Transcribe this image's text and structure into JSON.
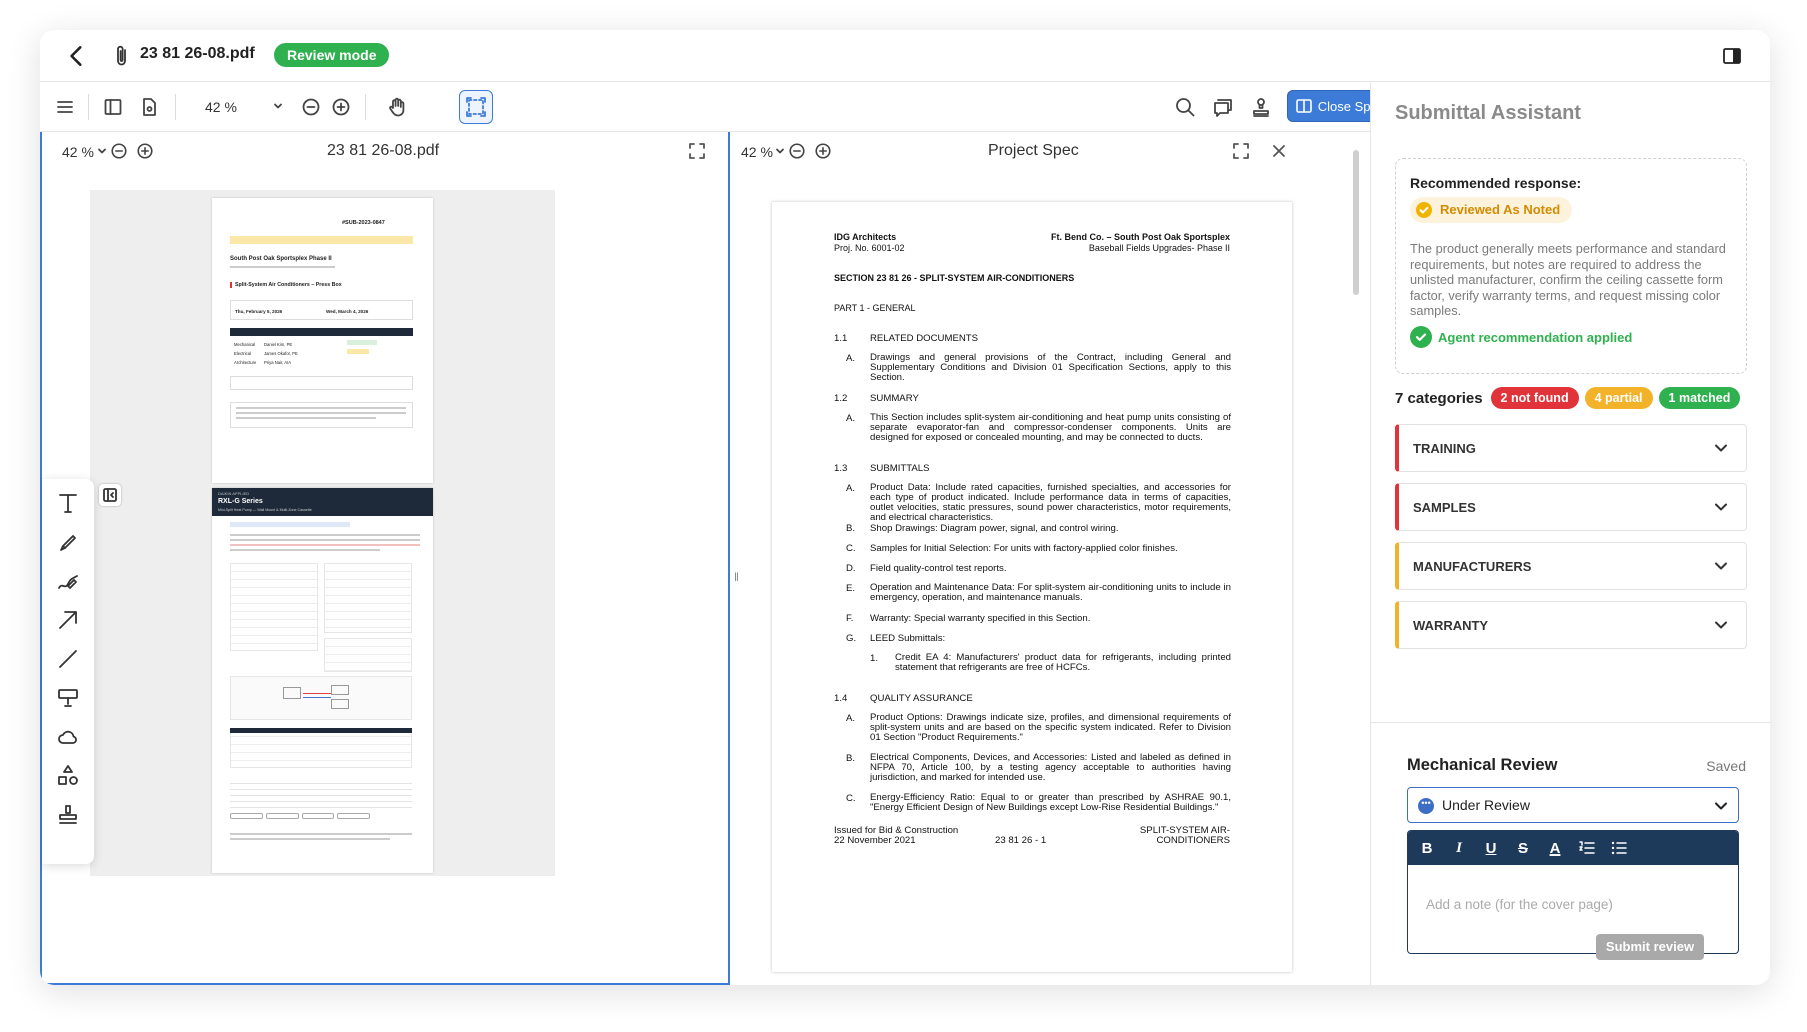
{
  "header": {
    "filename": "23 81 26-08.pdf",
    "mode_badge": "Review mode"
  },
  "toolbar": {
    "zoom": "42 %",
    "close_spec": "Close Spec"
  },
  "left_pane": {
    "zoom": "42 %",
    "title": "23 81 26-08.pdf"
  },
  "right_pane": {
    "zoom": "42 %",
    "title": "Project Spec"
  },
  "thumb1": {
    "id": "#SUB-2023-0847",
    "project": "South Post Oak Sportsplex Phase II",
    "item": "Split-System Air Conditioners – Press Box",
    "received": "Thu, February 5, 2026",
    "due": "Wed, March 4, 2026",
    "disciplines": [
      "Mechanical",
      "Electrical",
      "Architecture"
    ],
    "reviewers": [
      "Daniel Kim, PE",
      "James Okafor, PE",
      "Priya Nair, AIA"
    ]
  },
  "thumb2": {
    "brand": "DAIKIN APPLIED",
    "series": "RXL-G Series",
    "sub": "Mini-Split Heat Pump — Wall Mount & Multi-Zone Cassette"
  },
  "spec": {
    "firm": "IDG Architects",
    "proj_no": "Proj. No. 6001-02",
    "client": "Ft. Bend Co. – South Post Oak Sportsplex",
    "client2": "Baseball Fields Upgrades- Phase II",
    "section": "SECTION 23 81 26 - SPLIT-SYSTEM AIR-CONDITIONERS",
    "part": "PART 1 - GENERAL",
    "h11n": "1.1",
    "h11": "RELATED DOCUMENTS",
    "p11a": "Drawings and general provisions of the Contract, including General and Supplementary Conditions and Division 01 Specification Sections, apply to this Section.",
    "h12n": "1.2",
    "h12": "SUMMARY",
    "p12a": "This Section includes split-system air-conditioning and heat pump units consisting of separate evaporator-fan and compressor-condenser components. Units are designed for exposed or concealed mounting, and may be connected to ducts.",
    "h13n": "1.3",
    "h13": "SUBMITTALS",
    "p13a": "Product Data: Include rated capacities, furnished specialties, and accessories for each type of product indicated. Include performance data in terms of capacities, outlet velocities, static pressures, sound power characteristics, motor requirements, and electrical characteristics.",
    "p13b": "Shop Drawings: Diagram power, signal, and control wiring.",
    "p13c": "Samples for Initial Selection: For units with factory-applied color finishes.",
    "p13d": "Field quality-control test reports.",
    "p13e": "Operation and Maintenance Data: For split-system air-conditioning units to include in emergency, operation, and maintenance manuals.",
    "p13f": "Warranty: Special warranty specified in this Section.",
    "p13g": "LEED Submittals:",
    "p13g1": "Credit EA 4: Manufacturers' product data for refrigerants, including printed statement that refrigerants are free of HCFCs.",
    "h14n": "1.4",
    "h14": "QUALITY ASSURANCE",
    "p14a": "Product Options: Drawings indicate size, profiles, and dimensional requirements of split-system units and are based on the specific system indicated. Refer to Division 01 Section \"Product Requirements.\"",
    "p14b": "Electrical Components, Devices, and Accessories: Listed and labeled as defined in NFPA 70, Article 100, by a testing agency acceptable to authorities having jurisdiction, and marked for intended use.",
    "p14c": "Energy-Efficiency Ratio: Equal to or greater than prescribed by ASHRAE 90.1, \"Energy Efficient Design of New Buildings except Low-Rise Residential Buildings.\"",
    "footer_l1": "Issued for Bid & Construction",
    "footer_l2": "22 November 2021",
    "footer_c": "23 81 26 - 1",
    "footer_r1": "SPLIT-SYSTEM AIR-",
    "footer_r2": "CONDITIONERS",
    "letters": [
      "A.",
      "A.",
      "A.",
      "B.",
      "C.",
      "D.",
      "E.",
      "F.",
      "G.",
      "1.",
      "A.",
      "B.",
      "C."
    ]
  },
  "assistant": {
    "title": "Submittal Assistant",
    "rec_label": "Recommended response:",
    "rec_badge": "Reviewed As Noted",
    "rec_desc": "The product generally meets performance and standard requirements, but notes are required to address the unlisted manufacturer, confirm the ceiling cassette form factor, verify warranty terms, and request missing color samples.",
    "applied": "Agent recommendation applied",
    "categories": "7 categories",
    "pills": [
      "2 not found",
      "4 partial",
      "1 matched"
    ],
    "pill_colors": [
      "#e0333a",
      "#f2b22a",
      "#2fb14f"
    ],
    "sections": [
      "TRAINING",
      "SAMPLES",
      "MANUFACTURERS",
      "WARRANTY"
    ],
    "section_colors": [
      "#e0333a",
      "#e0333a",
      "#f2b22a",
      "#f2b22a"
    ],
    "review_title": "Mechanical Review",
    "saved": "Saved",
    "status": "Under Review",
    "editor_tools": [
      "B",
      "I",
      "U",
      "S",
      "A"
    ],
    "note_placeholder": "Add a note (for the cover page)",
    "submit": "Submit review"
  }
}
